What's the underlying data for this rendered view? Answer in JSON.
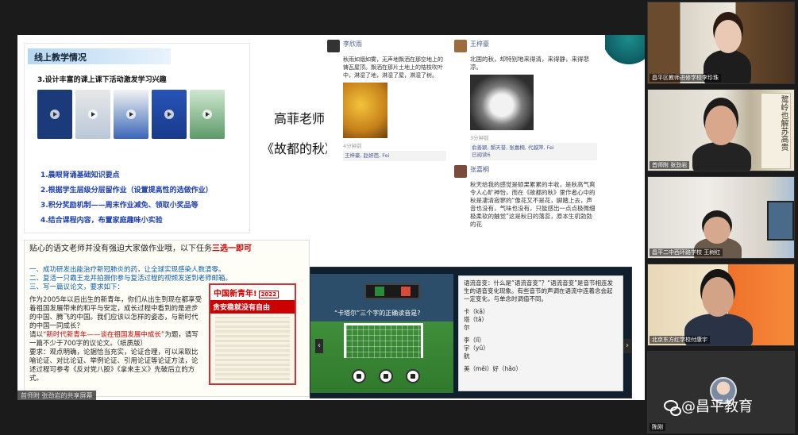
{
  "slide1": {
    "title": "线上教学情况",
    "subtitle": "3.设计丰富的课上课下活动激发学习兴趣",
    "items": [
      "1.晨眼背诵基础知识要点",
      "2.根据学生层级分层留作业（设置提高性的选做作业）",
      "3.积分奖励机制——周末作业减免、领取小奖品等",
      "4.结合课程内容，布置家庭趣味小实验"
    ]
  },
  "center": {
    "line1": "高菲老师",
    "line2": "《故都的秋》"
  },
  "chat1": {
    "name": "李欣雨",
    "text": "秋雨如烟如雾，无声地飘洒在那空地上的铸瓦屋顶。飘洒在那片土地上的桔枝吹叶中，淋湿了地，淋湿了屋，淋湿了树。",
    "time": "4分钟前",
    "likes": "王梓豪, 赵妍芭, Fei"
  },
  "chat2": {
    "name1": "王梓豪",
    "text1": "北国的秋，却特别地来得清，来得静，来得悲凉。",
    "time": "3分钟前",
    "likes": "俞善颖, 郝天誉, 张嘉桐, 代越萍, Fei",
    "views": "已阅读6",
    "name2": "张嘉桐",
    "text2": "秋天给我的感觉是硕果累累的丰收，是秋高气爽令人心旷神怡，而在《故都的秋》里作者心中的秋是凄清寂寥的“像花又不是花，脚踏上去，声音也没有，气味也没有，只能感出一点点极微细极柔软的触觉”这是秋日的落蕊，原本生机勃勃的花"
  },
  "homework": {
    "head_pre": "贴心的语文老师并没有强迫大家做作业哦，以下任务",
    "head_em": "三选一即可",
    "tasks": [
      "一、成功研发出能治疗新冠肺炎的药，让全球实现感染人数清零。",
      "二、复活一只霸王龙并拍摄你参与复活过程的视频发送到老师邮箱。",
      "三、写一篇议论文，要求如下："
    ],
    "body": "作为2005年以后出生的新青年，你们从出生到现在都享受着祖国发展带来的和平与安定，成长过程中看到的是进步的中国、腾飞的中国。我们应该以怎样的姿态，与新时代的中国一同成长？",
    "prompt_pre": "请以",
    "prompt_red": "“新时代新青年——谈在祖国发展中成长”",
    "prompt_post": "为题，请写一篇不少于700字的议论文。（纸质版）",
    "requirements": "要求：观点明确，论据恰当充实，论证合理，可以采取比喻论证、对比论证、举例论证、引用论证等论证方法，论述过程可参考《反对党八股》《拿来主义》先破后立的方式。",
    "poster_title": "中国新青年!",
    "poster_year": "2022",
    "poster_band": "贪安稳就没有自由"
  },
  "game": {
    "sign": "“卡塔尔”三个字的正确读音是?",
    "question": "语流音变：什么是“语流音变”？“语流音变”是音节相连发生的语音变化现象。有些音节的声调在语流中连着念会起一定变化，与单念时调值不同。",
    "answers": [
      "卡（kǎ）",
      "塔（tǎ）",
      "尔",
      "",
      "李（lǐ）",
      "宇（yǔ）",
      "航",
      "",
      "美（měi）好（hǎo）"
    ]
  },
  "share_label": "首师附 张劲岩的共享屏幕",
  "tiles": [
    "昌平区教师进修学校李珍珠",
    "首师附 张劲岩",
    "昌平二中西环路学校 王树红",
    "北京东方红学校付康宇",
    "陈刚"
  ],
  "calligraphy": "鹜岭也解苏高贵",
  "watermark": "@昌平教育"
}
